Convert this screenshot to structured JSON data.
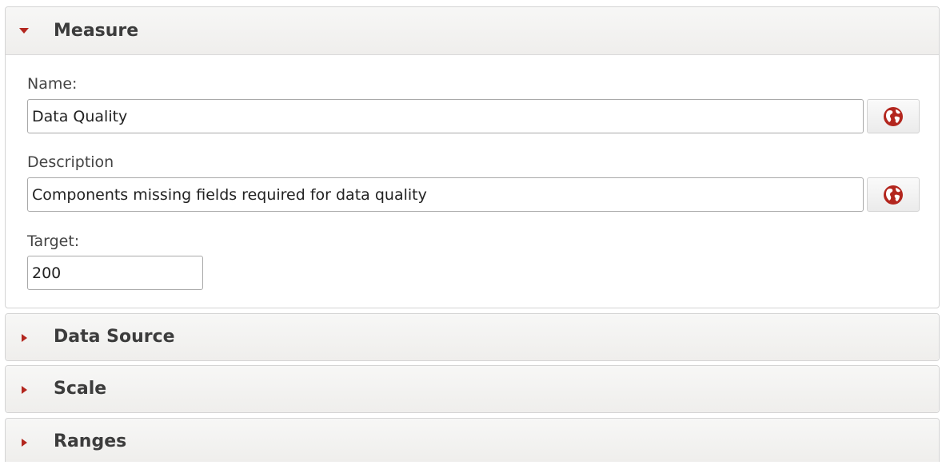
{
  "sections": {
    "measure": {
      "title": "Measure",
      "expanded": true,
      "name_label": "Name:",
      "name_value": "Data Quality",
      "description_label": "Description",
      "description_value": "Components missing fields required for data quality",
      "target_label": "Target:",
      "target_value": "200",
      "translate_icon": "globe-icon"
    },
    "data_source": {
      "title": "Data Source",
      "expanded": false
    },
    "scale": {
      "title": "Scale",
      "expanded": false
    },
    "ranges": {
      "title": "Ranges",
      "expanded": false
    }
  },
  "colors": {
    "accent_arrow": "#b3261e",
    "globe": "#b3261e",
    "header_bg": "#efeeec"
  }
}
